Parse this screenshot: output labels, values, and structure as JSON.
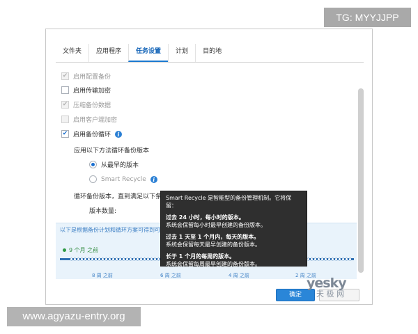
{
  "watermarks": {
    "top": "TG: MYYJJPP",
    "bottom": "www.agyazu-entry.org",
    "logo_line1": "yesky",
    "logo_line2": "天 极 网"
  },
  "tabs": [
    {
      "label": "文件夹",
      "active": false
    },
    {
      "label": "应用程序",
      "active": false
    },
    {
      "label": "任务设置",
      "active": true
    },
    {
      "label": "计划",
      "active": false
    },
    {
      "label": "目的地",
      "active": false
    }
  ],
  "options": {
    "config_backup": {
      "label": "启用配置备份",
      "checked": true,
      "disabled": true
    },
    "transfer_encrypt": {
      "label": "启用传输加密",
      "checked": false,
      "disabled": false
    },
    "compress": {
      "label": "压缩备份数据",
      "checked": true,
      "disabled": true
    },
    "client_encrypt": {
      "label": "启用客户端加密",
      "checked": false,
      "disabled": true
    },
    "rotation": {
      "label": "启用备份循环",
      "checked": true,
      "disabled": false
    }
  },
  "rotation": {
    "method_label": "应用以下方法循环备份版本",
    "from_oldest": "从最早的版本",
    "smart_recycle": "Smart Recycle",
    "condition_label": "循环备份版本，直到满足以下条件：",
    "version_count_label": "版本数量:"
  },
  "tooltip": {
    "intro": "Smart Recycle 是智能型的备份管理机制。它将保留：",
    "p1_title": "过去 24 小时，每小时的版本。",
    "p1_desc": "系统会保留每小时最早创建的备份版本。",
    "p2_title": "过去 1 天至 1 个月内，每天的版本。",
    "p2_desc": "系统会保留每天最早创建的备份版本。",
    "p3_title": "长于 1 个月的每周的版本。",
    "p3_desc": "系统会保留每周最早创建的备份版本。"
  },
  "timeline": {
    "description": "以下是根据备份计划和循环方案可得到可",
    "start": "9 个月 之前",
    "ticks": [
      "8 周 之前",
      "6 周 之前",
      "4 周 之前",
      "2 周 之前"
    ]
  },
  "buttons": {
    "ok": "确定",
    "cancel": ""
  }
}
